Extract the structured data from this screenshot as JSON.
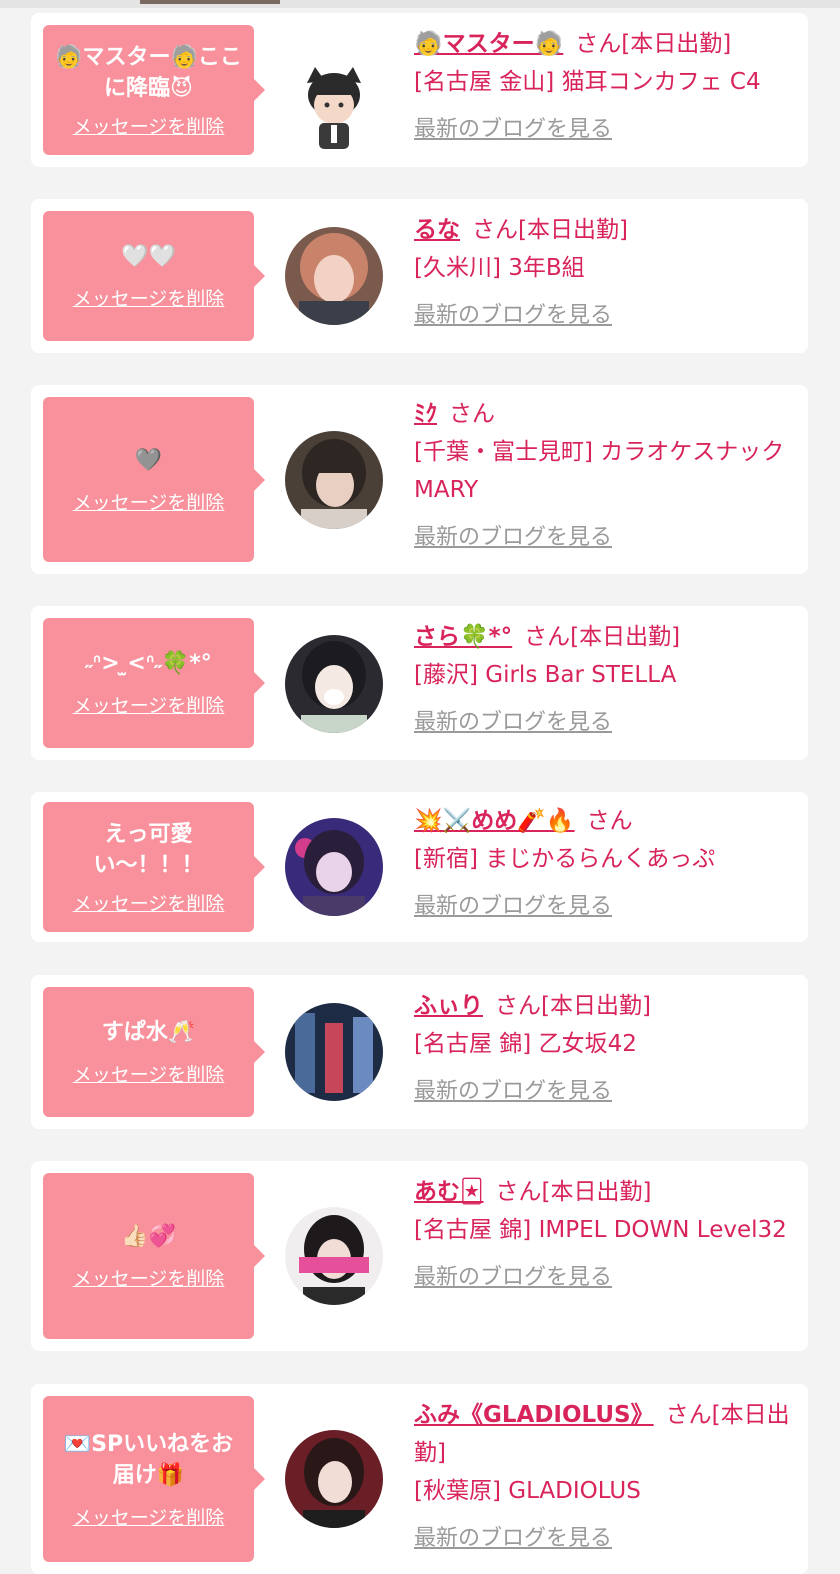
{
  "delete_label": "メッセージを削除",
  "blog_label": "最新のブログを見る",
  "san_label": "さん",
  "colors": {
    "accent": "#d8245a",
    "bubble": "#f8919b",
    "link_gray": "#9a9a9a"
  },
  "cards": [
    {
      "bubble_text": "🧓マスター🧓ここに降臨😈",
      "name": "🧓マスター🧓",
      "status": "[本日出勤]",
      "shop": "[名古屋 金山] 猫耳コンカフェ C4",
      "avatar_icon": "cartoon-avatar-icon"
    },
    {
      "bubble_text": "🤍🤍",
      "name": "るな",
      "status": "[本日出勤]",
      "shop": "[久米川] 3年B組",
      "avatar_icon": "user-photo-icon"
    },
    {
      "bubble_text": "🩶",
      "name": "ﾐｸ",
      "status": "",
      "shop": "[千葉・富士見町] カラオケスナック MARY",
      "avatar_icon": "user-photo-icon"
    },
    {
      "bubble_text": "˶ᐢ> ̫<ᐢ˶🍀*°",
      "name": "さら🍀*°",
      "status": "[本日出勤]",
      "shop": "[藤沢] Girls Bar STELLA",
      "avatar_icon": "user-photo-icon"
    },
    {
      "bubble_text": "えっ可愛い〜！！！",
      "name": "💥⚔️めめ🧨🔥",
      "status": "",
      "shop": "[新宿] まじかるらんくあっぷ",
      "avatar_icon": "user-photo-icon"
    },
    {
      "bubble_text": "すぱ水🥂",
      "name": "ふぃり",
      "status": "[本日出勤]",
      "shop": "[名古屋 錦] 乙女坂42",
      "avatar_icon": "user-photo-icon"
    },
    {
      "bubble_text": "👍🏻💞",
      "name": "あむ🃏",
      "status": "[本日出勤]",
      "shop": "[名古屋 錦] IMPEL DOWN Level32",
      "avatar_icon": "user-photo-icon"
    },
    {
      "bubble_text": "💌SPいいねをお届け🎁",
      "name": "ふみ《GLADIOLUS》",
      "status": "[本日出勤]",
      "shop": "[秋葉原] GLADIOLUS",
      "avatar_icon": "user-photo-icon"
    }
  ]
}
